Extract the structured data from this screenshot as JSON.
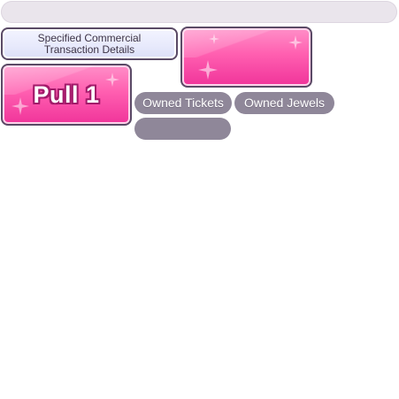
{
  "shop": {
    "details_label": "Specified Commercial Transaction Details",
    "pull_label": "Pull 1",
    "owned_tickets_label": "Owned Tickets",
    "owned_jewels_label": "Owned Jewels",
    "empty_pill_label": ""
  },
  "colors": {
    "accent_pink": "#ff5fb0",
    "button_border": "#5a4a66",
    "pill_gray": "#8f8799",
    "top_bar": "#eae5ec"
  },
  "icons": [
    "sparkle-icon"
  ]
}
